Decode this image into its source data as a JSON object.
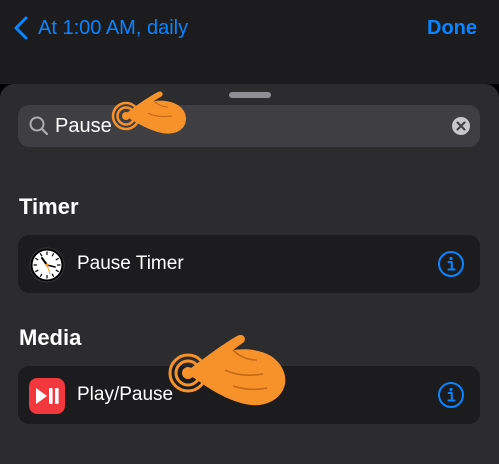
{
  "nav": {
    "back_title": "At 1:00 AM, daily",
    "done_label": "Done"
  },
  "search": {
    "value": "Pause",
    "clear_icon": "clear-circle-icon"
  },
  "sections": [
    {
      "title": "Timer",
      "row": {
        "label": "Pause Timer",
        "icon": "clock-icon"
      }
    },
    {
      "title": "Media",
      "row": {
        "label": "Play/Pause",
        "icon": "play-pause-icon"
      }
    }
  ],
  "colors": {
    "accent": "#0a84ff",
    "hand": "#f7922b",
    "media_icon": "#f2383c"
  }
}
